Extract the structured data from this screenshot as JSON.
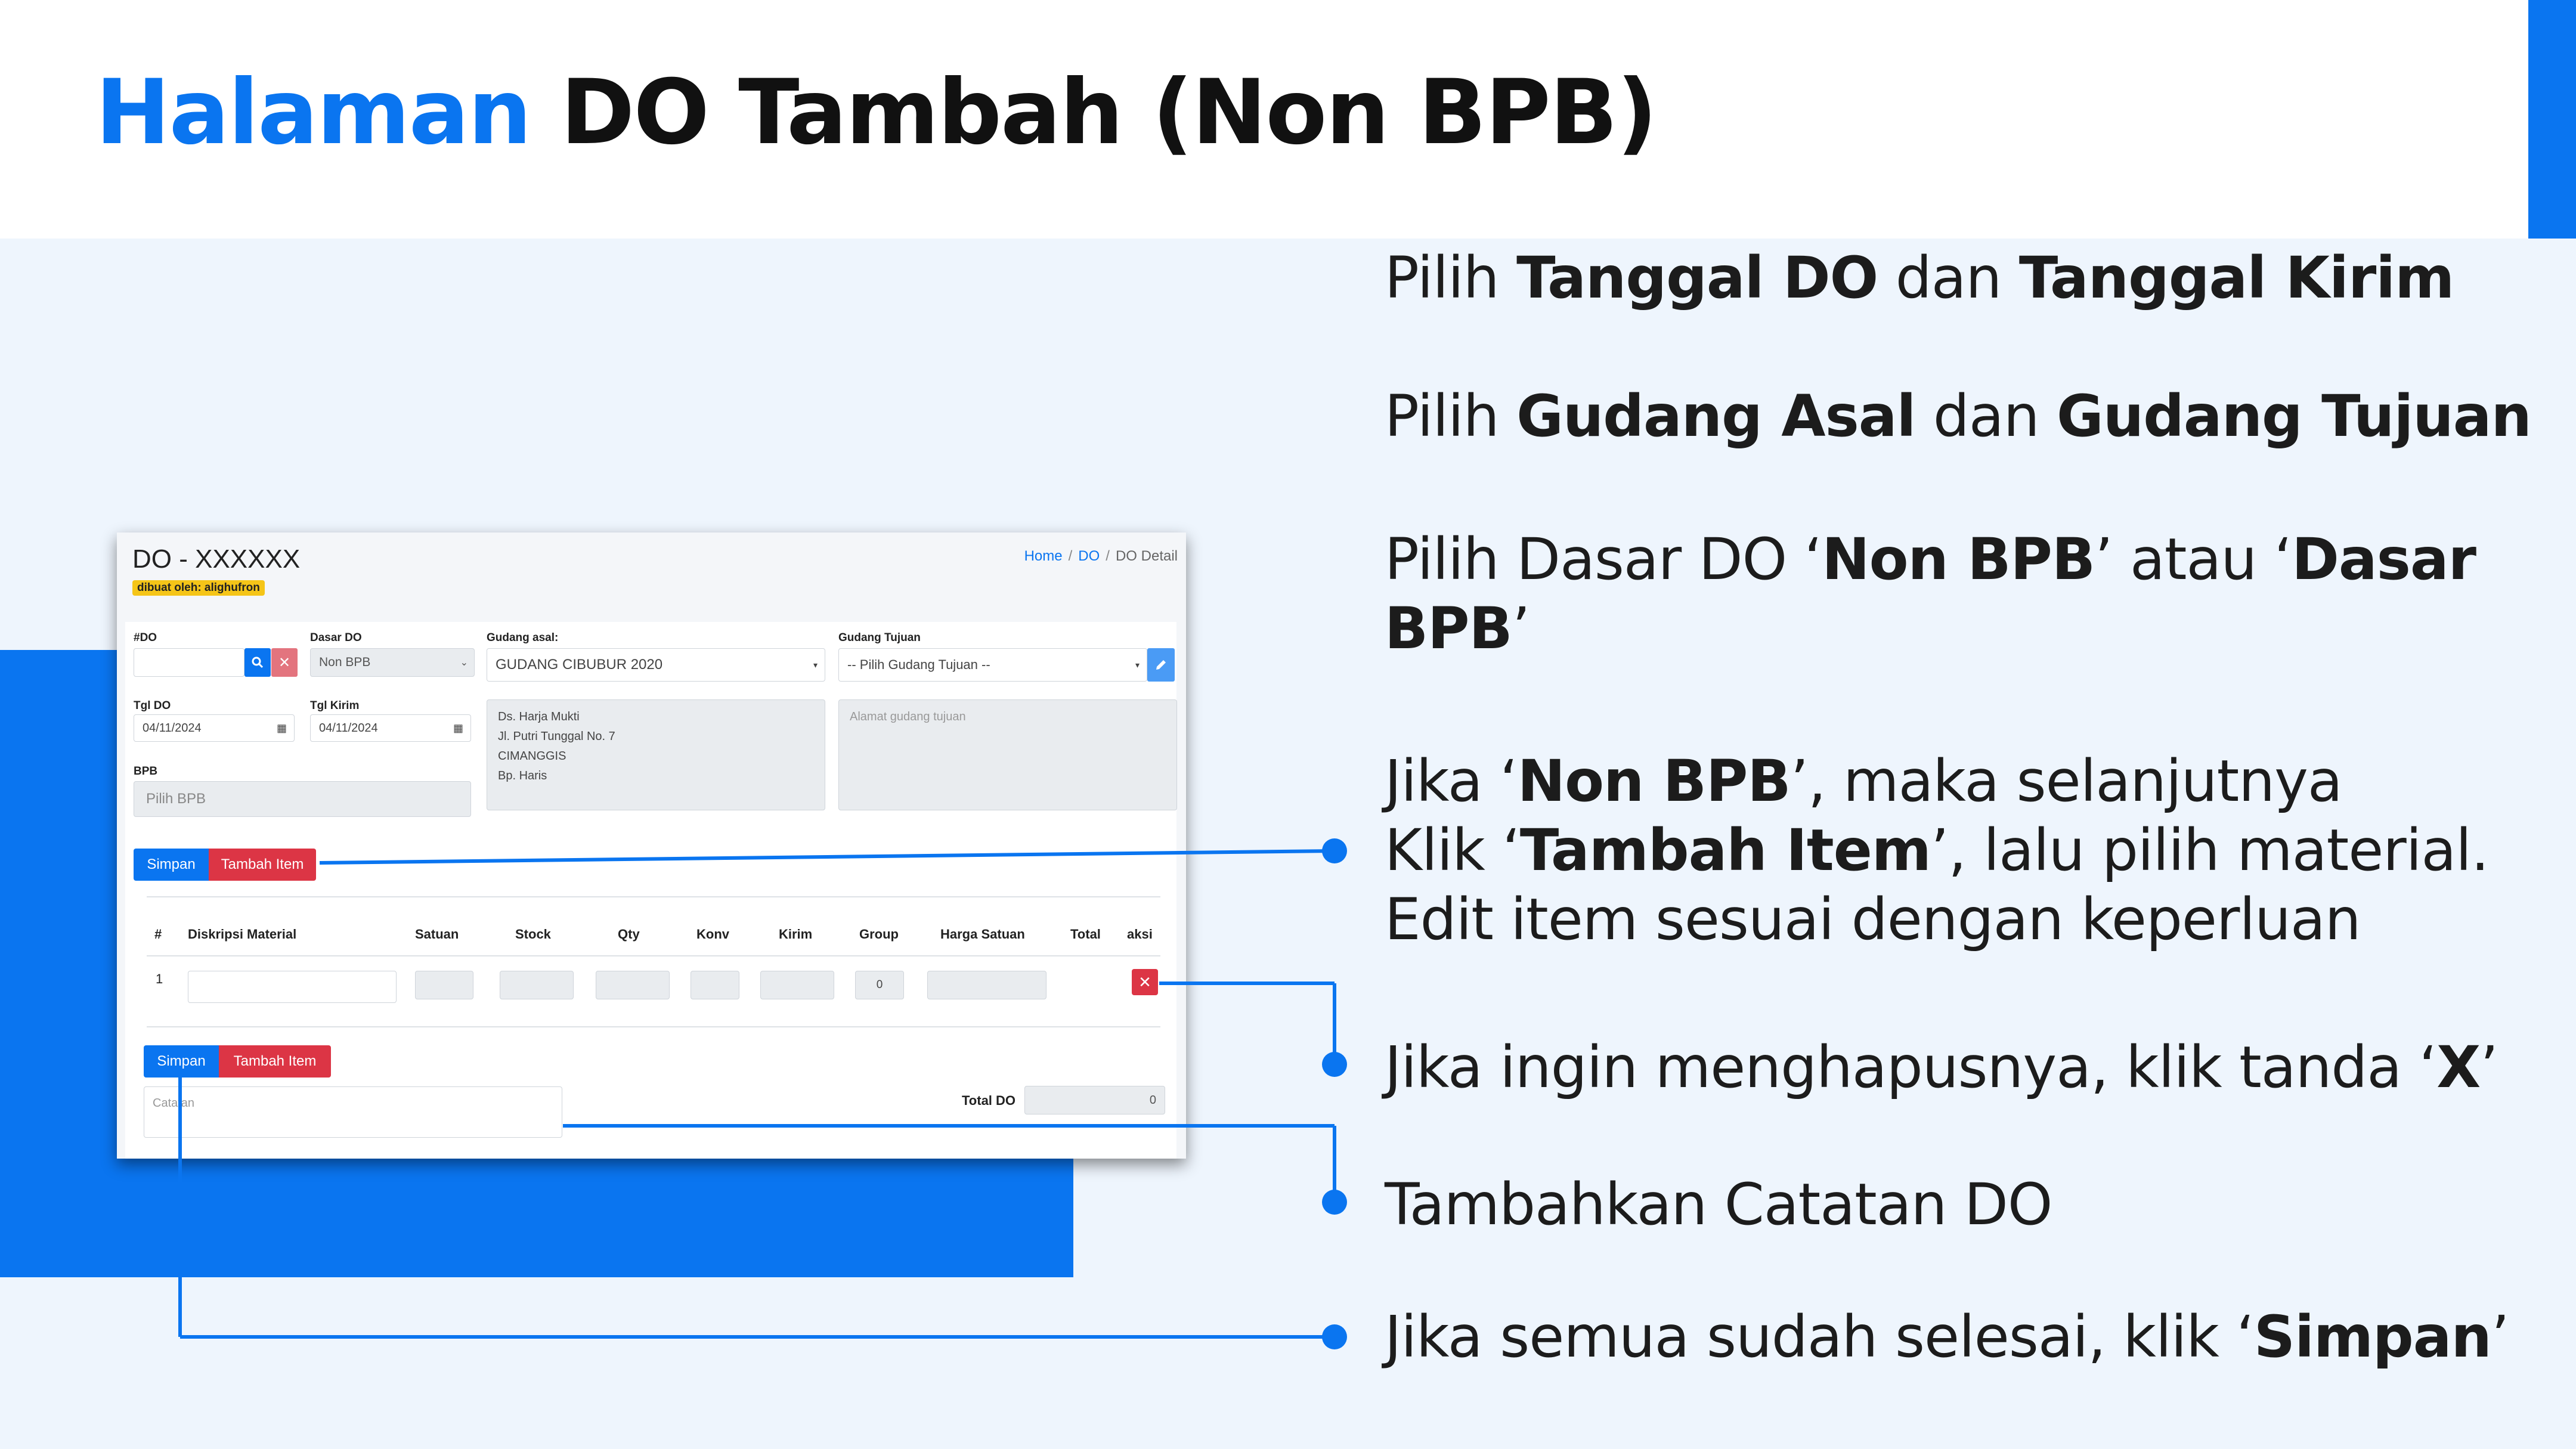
{
  "slide": {
    "title_accent": "Halaman",
    "title_rest": "DO Tambah (Non BPB)"
  },
  "app": {
    "title": "DO - XXXXXX",
    "badge": "dibuat oleh: alighufron",
    "breadcrumb": [
      "Home",
      "DO",
      "DO Detail"
    ],
    "form": {
      "do_label": "#DO",
      "do_value": "",
      "dasar_label": "Dasar DO",
      "dasar_value": "Non BPB",
      "gudang_asal_label": "Gudang asal:",
      "gudang_asal_value": "GUDANG CIBUBUR 2020",
      "gudang_tujuan_label": "Gudang Tujuan",
      "gudang_tujuan_value": "-- Pilih Gudang Tujuan --",
      "tgl_do_label": "Tgl DO",
      "tgl_do_value": "04/11/2024",
      "tgl_kirim_label": "Tgl Kirim",
      "tgl_kirim_value": "04/11/2024",
      "alamat_asal": [
        "Ds. Harja Mukti",
        "Jl. Putri Tunggal No. 7",
        "CIMANGGIS",
        "Bp. Haris"
      ],
      "alamat_tujuan_placeholder": "Alamat gudang tujuan",
      "bpb_label": "BPB",
      "bpb_placeholder": "Pilih BPB"
    },
    "buttons": {
      "simpan": "Simpan",
      "tambah_item": "Tambah Item"
    },
    "table": {
      "headers": [
        "#",
        "Diskripsi Material",
        "Satuan",
        "Stock",
        "Qty",
        "Konv",
        "Kirim",
        "Group",
        "Harga Satuan",
        "Total",
        "aksi"
      ],
      "rows": [
        {
          "no": "1",
          "group": "0"
        }
      ]
    },
    "catatan_placeholder": "Catatan",
    "total_do_label": "Total DO",
    "total_do_value": "0"
  },
  "instructions": {
    "i1": {
      "a": "Pilih ",
      "b": "Tanggal DO",
      "c": " dan ",
      "d": "Tanggal Kirim"
    },
    "i2": {
      "a": "Pilih ",
      "b": "Gudang Asal",
      "c": " dan ",
      "d": "Gudang Tujuan"
    },
    "i3": {
      "a": "Pilih Dasar DO ‘",
      "b": "Non BPB",
      "c": "’ atau ‘",
      "d": "Dasar",
      "e": "BPB",
      "f": "’"
    },
    "i4": {
      "a": "Jika ‘",
      "b": "Non BPB",
      "c": "’, maka selanjutnya",
      "d": "Klik ‘",
      "e": "Tambah Item",
      "f": "’, lalu pilih material.",
      "g": "Edit item sesuai dengan keperluan"
    },
    "i5": {
      "a": "Jika ingin menghapusnya, klik tanda ‘",
      "b": "X",
      "c": "’"
    },
    "i6": {
      "a": "Tambahkan Catatan DO"
    },
    "i7": {
      "a": "Jika semua sudah selesai, klik ‘",
      "b": "Simpan",
      "c": "’"
    }
  },
  "colors": {
    "accent": "#0a75f0",
    "danger": "#dc3545",
    "badge": "#f5c518",
    "panel_bg": "#eef5fd"
  }
}
